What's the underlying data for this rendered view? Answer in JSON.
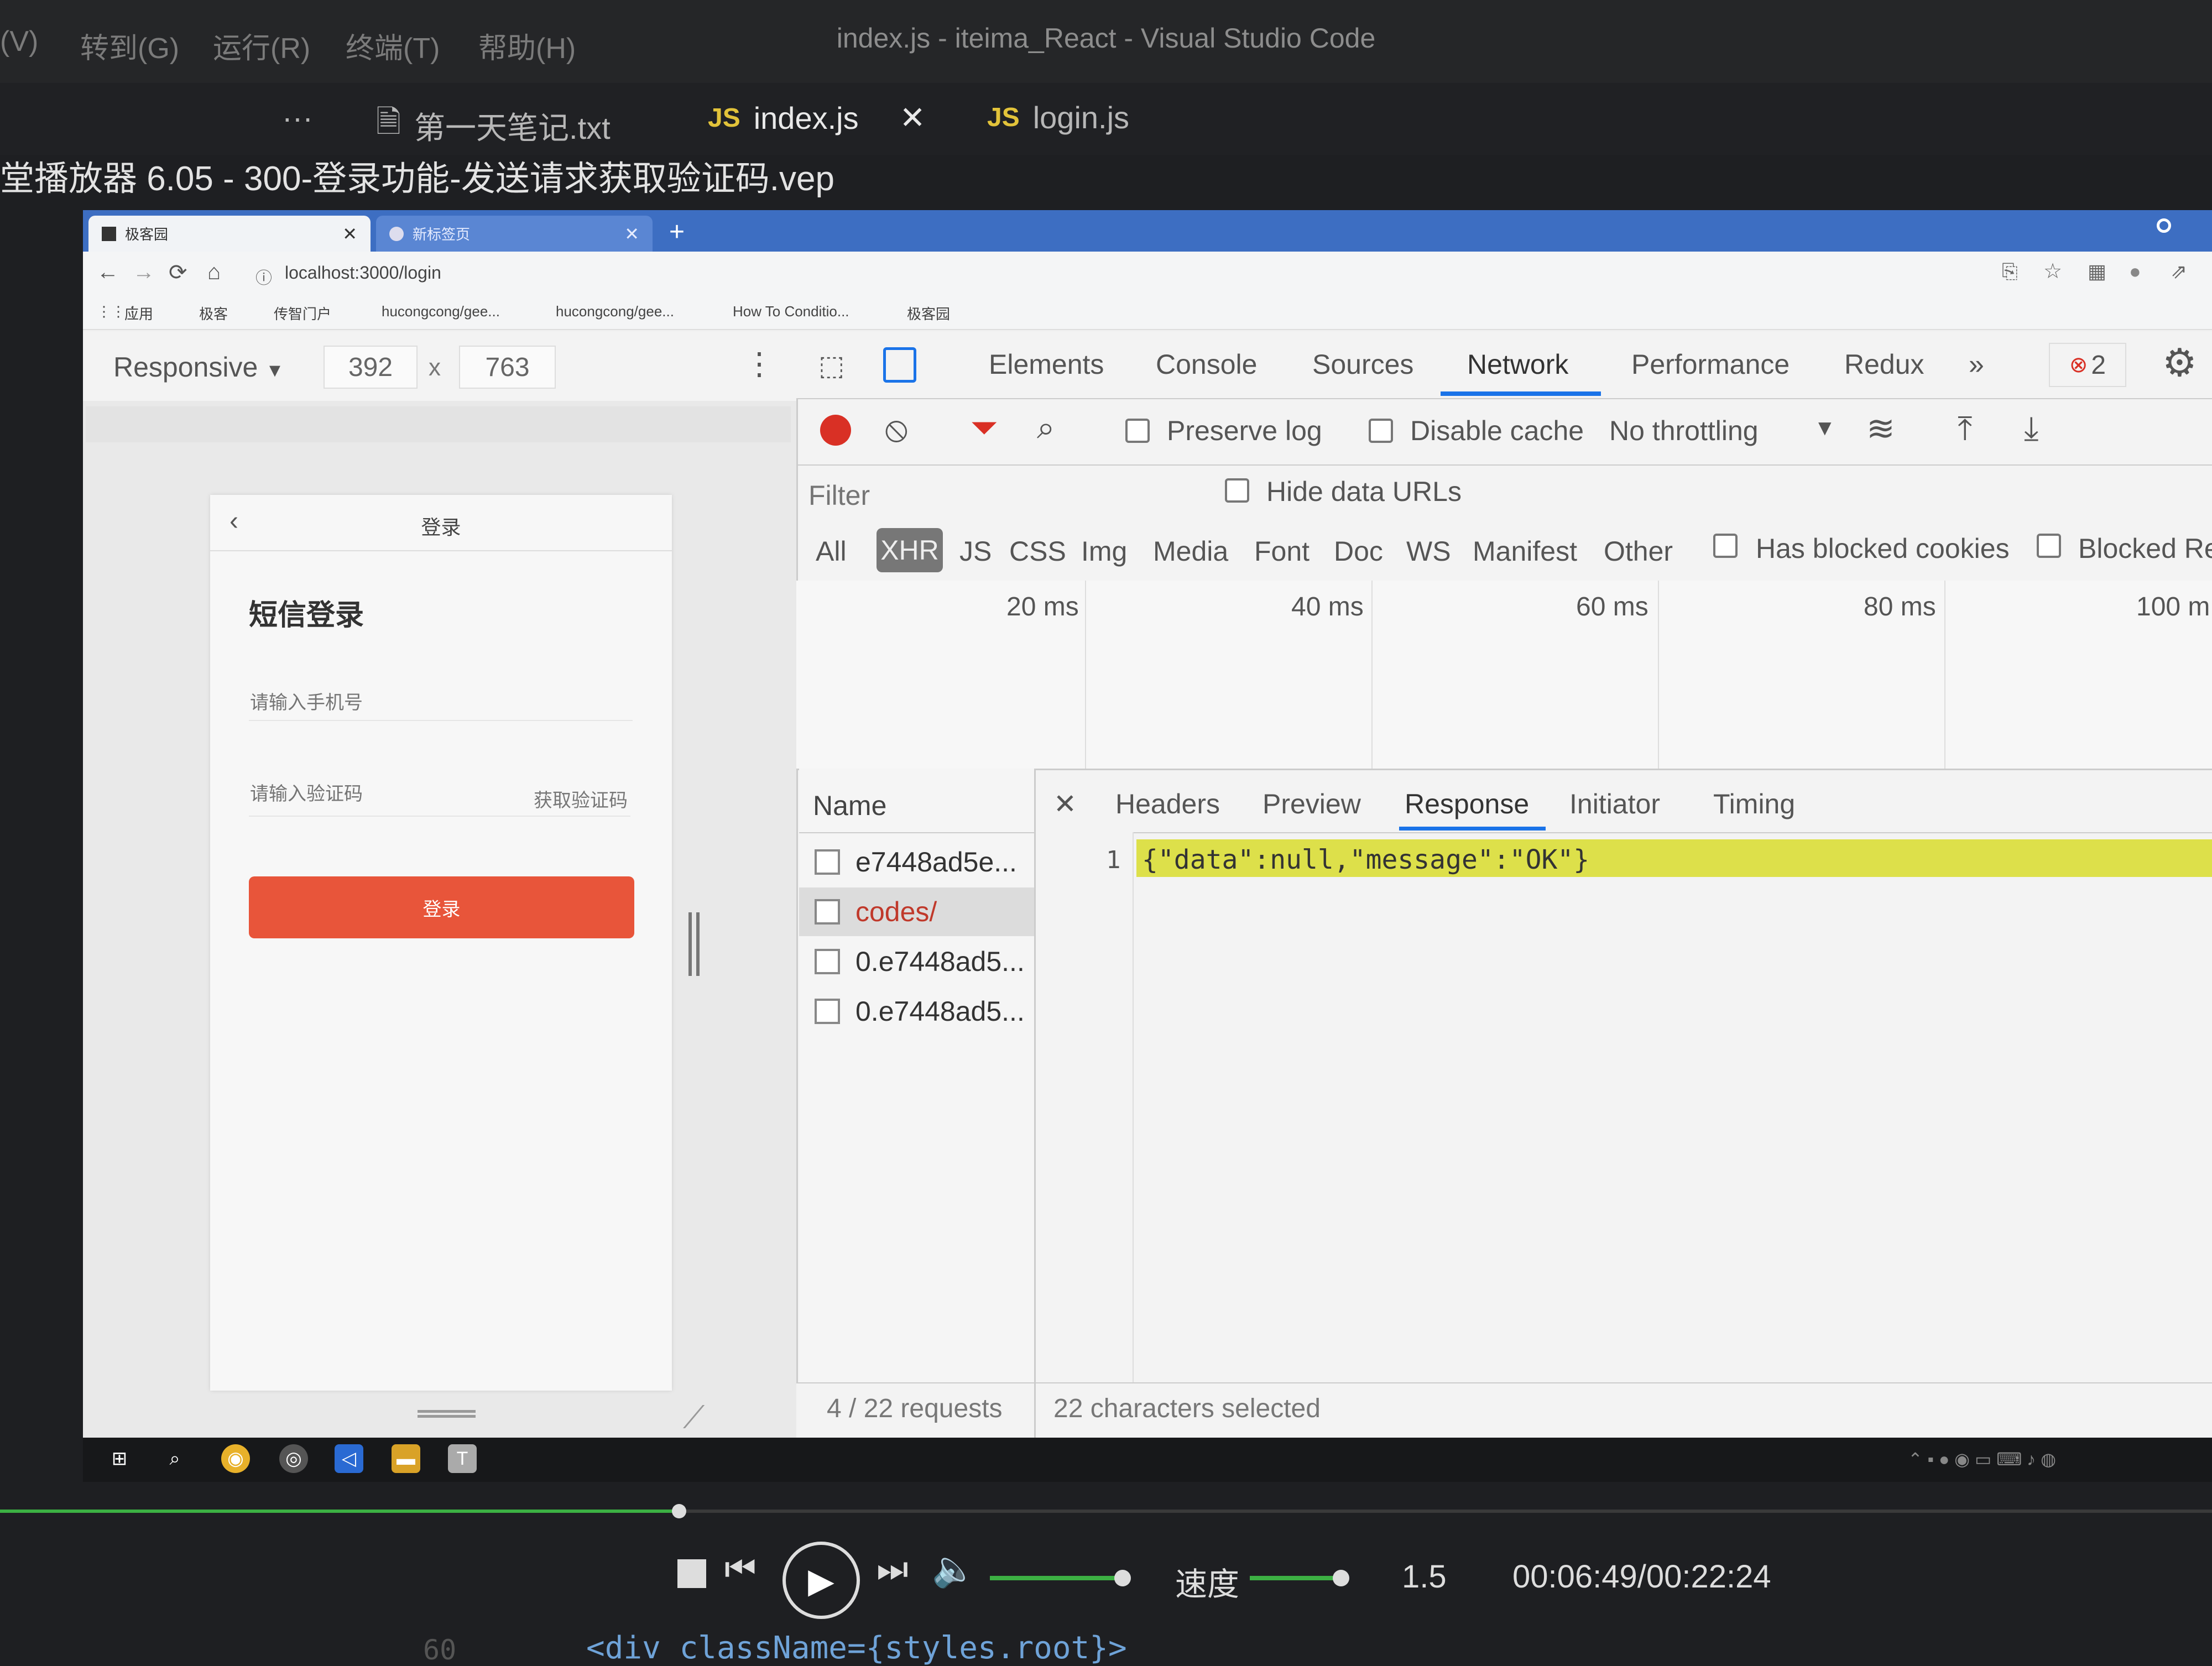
{
  "vscode": {
    "menu": [
      "(V)",
      "转到(G)",
      "运行(R)",
      "终端(T)",
      "帮助(H)"
    ],
    "window_title": "index.js - iteima_React - Visual Studio Code",
    "tabs": [
      {
        "label": "第一天笔记.txt",
        "icon": "text-file-icon"
      },
      {
        "label": "index.js",
        "icon": "js-file-icon",
        "active": true
      },
      {
        "label": "login.js",
        "icon": "js-file-icon"
      }
    ],
    "overflow_label": "···",
    "close_label": "✕",
    "js_badge": "JS"
  },
  "player_title": "堂播放器 6.05 - 300-登录功能-发送请求获取验证码.vep",
  "browser": {
    "tabs": [
      {
        "label": "极客园"
      },
      {
        "label": "新标签页"
      }
    ],
    "url": "localhost:3000/login",
    "bookmarks": [
      "应用",
      "极客",
      "传智门户",
      "hucongcong/gee...",
      "hucongcong/gee...",
      "How To Conditio...",
      "极客园"
    ]
  },
  "device_toolbar": {
    "mode": "Responsive",
    "width": "392",
    "times": "x",
    "height": "763"
  },
  "app": {
    "header_title": "登录",
    "back": "‹",
    "sms_title": "短信登录",
    "phone_placeholder": "请输入手机号",
    "code_placeholder": "请输入验证码",
    "get_code": "获取验证码",
    "login_button": "登录"
  },
  "devtools": {
    "tabs": [
      "Elements",
      "Console",
      "Sources",
      "Network",
      "Performance",
      "Redux"
    ],
    "more": "»",
    "error_count": "2",
    "toolbar": {
      "preserve_log": "Preserve log",
      "disable_cache": "Disable cache",
      "throttling": "No throttling"
    },
    "filter_placeholder": "Filter",
    "hide_data_urls": "Hide data URLs",
    "types": [
      "All",
      "XHR",
      "JS",
      "CSS",
      "Img",
      "Media",
      "Font",
      "Doc",
      "WS",
      "Manifest",
      "Other"
    ],
    "has_blocked_cookies": "Has blocked cookies",
    "blocked_requests": "Blocked Re",
    "timeline_ticks": [
      "20 ms",
      "40 ms",
      "60 ms",
      "80 ms",
      "100 m"
    ],
    "name_header": "Name",
    "requests": [
      {
        "name": "e7448ad5e..."
      },
      {
        "name": "codes/",
        "selected": true
      },
      {
        "name": "0.e7448ad5..."
      },
      {
        "name": "0.e7448ad5..."
      }
    ],
    "detail_tabs": [
      "Headers",
      "Preview",
      "Response",
      "Initiator",
      "Timing"
    ],
    "detail_close": "✕",
    "response_line_number": "1",
    "response_text": "{\"data\":null,\"message\":\"OK\"}",
    "status_requests": "4 / 22 requests",
    "status_selection": "22 characters selected"
  },
  "player": {
    "progress": 0.307,
    "speed_label": "速度",
    "speed_value": "1.5",
    "time": "00:06:49/00:22:24"
  },
  "code_below": {
    "line_number": "60",
    "text": "<div className={styles.root}>"
  }
}
